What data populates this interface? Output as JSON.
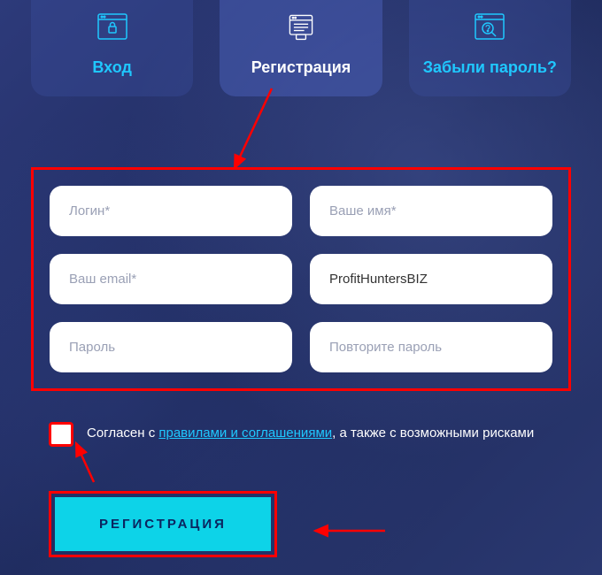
{
  "tabs": {
    "login": {
      "label": "Вход"
    },
    "register": {
      "label": "Регистрация"
    },
    "forgot": {
      "label": "Забыли пароль?"
    }
  },
  "form": {
    "login_placeholder": "Логин*",
    "name_placeholder": "Ваше имя*",
    "email_placeholder": "Ваш email*",
    "referrer_value": "ProfitHuntersBIZ",
    "password_placeholder": "Пароль",
    "password2_placeholder": "Повторите пароль"
  },
  "agreement": {
    "prefix": "Согласен с ",
    "link": "правилами и соглашениями",
    "suffix": ", а также с возможными рисками"
  },
  "submit": {
    "label": "РЕГИСТРАЦИЯ"
  }
}
